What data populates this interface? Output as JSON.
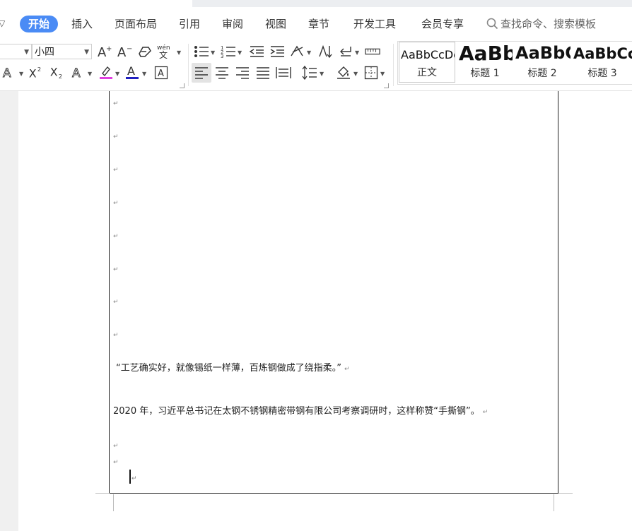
{
  "menu": {
    "tabs": [
      {
        "label": "开始"
      },
      {
        "label": "插入"
      },
      {
        "label": "页面布局"
      },
      {
        "label": "引用"
      },
      {
        "label": "审阅"
      },
      {
        "label": "视图"
      },
      {
        "label": "章节"
      },
      {
        "label": "开发工具"
      },
      {
        "label": "会员专享"
      }
    ],
    "search_label": "查找命令、搜索模板"
  },
  "ribbon": {
    "font_name": "",
    "font_size": "小四",
    "styles": [
      {
        "preview": "AaBbCcDd",
        "name": "正文"
      },
      {
        "preview": "AaBb",
        "name": "标题 1"
      },
      {
        "preview": "AaBbC",
        "name": "标题 2"
      },
      {
        "preview": "AaBbCc",
        "name": "标题 3"
      }
    ],
    "colors": {
      "highlight": "#e040e0",
      "font_color": "#2020c0",
      "accent": "#4a8bf5"
    }
  },
  "document": {
    "paragraph_mark": "↵",
    "quote": "“工艺确实好，就像锡纸一样薄，百炼钢做成了绕指柔。”",
    "sentence": "2020 年，习近平总书记在太钢不锈钢精密带钢有限公司考察调研时，这样称赞“手撕钢”。"
  }
}
